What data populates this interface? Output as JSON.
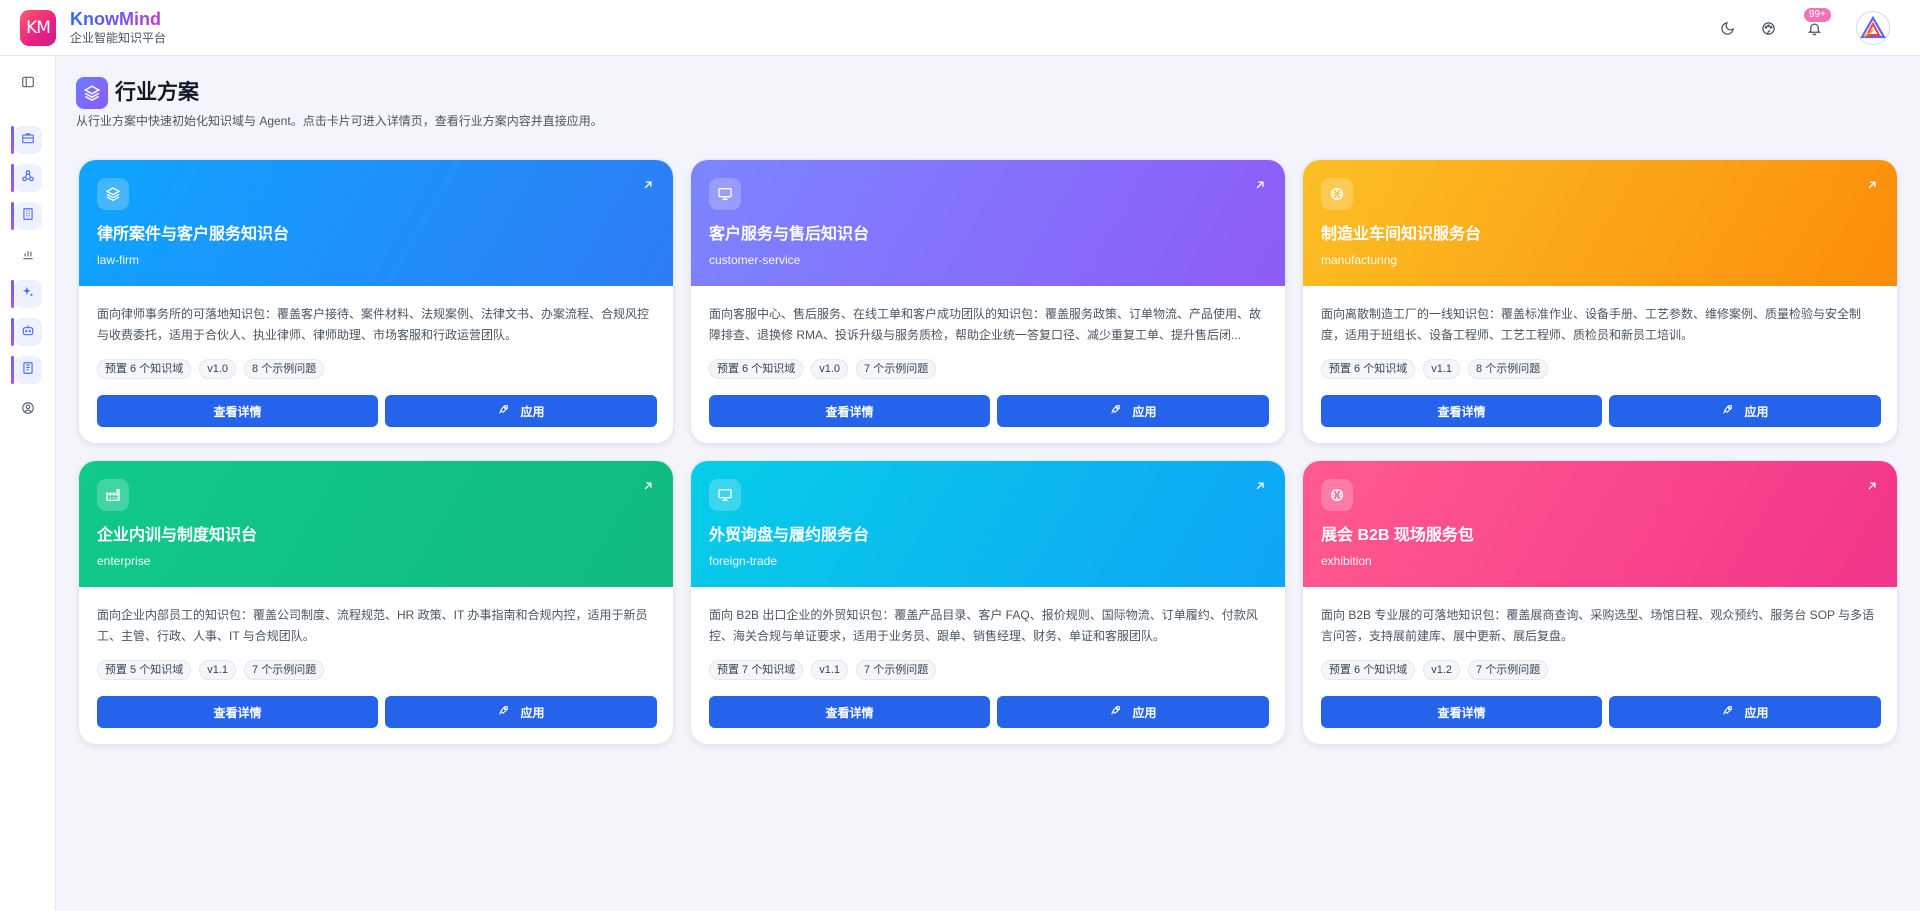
{
  "app": {
    "logo_text": "KM",
    "name": "KnowMind",
    "subtitle": "企业智能知识平台",
    "notification_count": "99+"
  },
  "page": {
    "title": "行业方案",
    "description": "从行业方案中快速初始化知识域与 Agent。点击卡片可进入详情页，查看行业方案内容并直接应用。"
  },
  "sidebar": {
    "items": [
      {
        "icon": "panel-toggle-icon",
        "active": false
      },
      {
        "icon": "briefcase-icon",
        "active": true
      },
      {
        "icon": "network-icon",
        "active": true
      },
      {
        "icon": "building-icon",
        "active": true
      },
      {
        "icon": "bar-chart-icon",
        "active": false
      },
      {
        "icon": "sparkles-icon",
        "active": true
      },
      {
        "icon": "robot-icon",
        "active": true
      },
      {
        "icon": "book-icon",
        "active": true
      },
      {
        "icon": "user-circle-icon",
        "active": false
      }
    ]
  },
  "actions": {
    "detail_label": "查看详情",
    "apply_label": "应用"
  },
  "cards": [
    {
      "title": "律所案件与客户服务知识台",
      "slug": "law-firm",
      "icon": "layers-icon",
      "gradient": [
        "#0ea5ff",
        "#2f7cf6"
      ],
      "description": "面向律师事务所的可落地知识包：覆盖客户接待、案件材料、法规案例、法律文书、办案流程、合规风控与收费委托，适用于合伙人、执业律师、律师助理、市场客服和行政运营团队。",
      "tags": [
        "预置 6 个知识域",
        "v1.0",
        "8 个示例问题"
      ]
    },
    {
      "title": "客户服务与售后知识台",
      "slug": "customer-service",
      "icon": "presentation-icon",
      "gradient": [
        "#7b85ff",
        "#8e5cf7"
      ],
      "description": "面向客服中心、售后服务、在线工单和客户成功团队的知识包：覆盖服务政策、订单物流、产品使用、故障排查、退换修 RMA、投诉升级与服务质检，帮助企业统一答复口径、减少重复工单、提升售后闭...",
      "tags": [
        "预置 6 个知识域",
        "v1.0",
        "7 个示例问题"
      ]
    },
    {
      "title": "制造业车间知识服务台",
      "slug": "manufacturing",
      "icon": "gear-icon",
      "gradient": [
        "#fbbf24",
        "#fb8c0a"
      ],
      "description": "面向离散制造工厂的一线知识包：覆盖标准作业、设备手册、工艺参数、维修案例、质量检验与安全制度，适用于班组长、设备工程师、工艺工程师、质检员和新员工培训。",
      "tags": [
        "预置 6 个知识域",
        "v1.1",
        "8 个示例问题"
      ]
    },
    {
      "title": "企业内训与制度知识台",
      "slug": "enterprise",
      "icon": "factory-icon",
      "gradient": [
        "#10c98a",
        "#12b981"
      ],
      "description": "面向企业内部员工的知识包：覆盖公司制度、流程规范、HR 政策、IT 办事指南和合规内控，适用于新员工、主管、行政、人事、IT 与合规团队。",
      "tags": [
        "预置 5 个知识域",
        "v1.1",
        "7 个示例问题"
      ]
    },
    {
      "title": "外贸询盘与履约服务台",
      "slug": "foreign-trade",
      "icon": "presentation-icon",
      "gradient": [
        "#06cde8",
        "#0ea5f5"
      ],
      "description": "面向 B2B 出口企业的外贸知识包：覆盖产品目录、客户 FAQ、报价规则、国际物流、订单履约、付款风控、海关合规与单证要求，适用于业务员、跟单、销售经理、财务、单证和客服团队。",
      "tags": [
        "预置 7 个知识域",
        "v1.1",
        "7 个示例问题"
      ]
    },
    {
      "title": "展会 B2B 现场服务包",
      "slug": "exhibition",
      "icon": "gear-icon",
      "gradient": [
        "#ff5a8f",
        "#f2358a"
      ],
      "description": "面向 B2B 专业展的可落地知识包：覆盖展商查询、采购选型、场馆日程、观众预约、服务台 SOP 与多语言问答，支持展前建库、展中更新、展后复盘。",
      "tags": [
        "预置 6 个知识域",
        "v1.2",
        "7 个示例问题"
      ]
    }
  ]
}
